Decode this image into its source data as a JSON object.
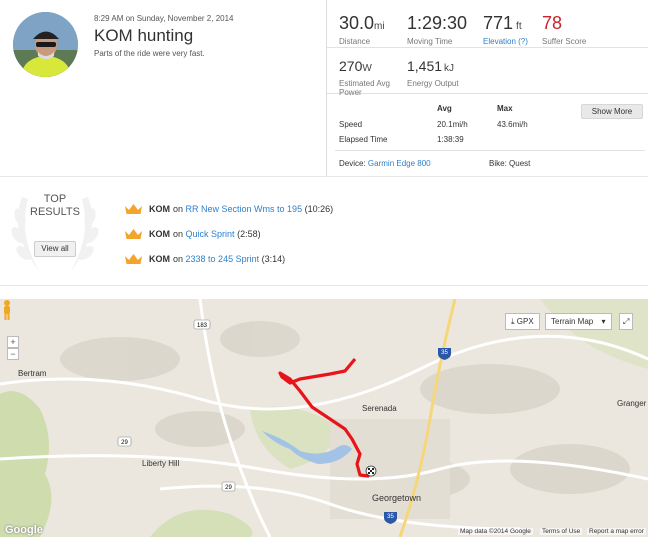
{
  "activity": {
    "timestamp": "8:29 AM on Sunday, November 2, 2014",
    "title": "KOM hunting",
    "description": "Parts of the ride were very fast."
  },
  "stats": {
    "distance": {
      "value": "30.0",
      "unit": "mi",
      "label": "Distance"
    },
    "moving_time": {
      "value": "1:29:30",
      "label": "Moving Time"
    },
    "elevation": {
      "value": "771",
      "unit": "ft",
      "label": "Elevation (?)"
    },
    "suffer": {
      "value": "78",
      "label": "Suffer Score"
    },
    "power": {
      "value": "270",
      "unit": "W",
      "label_line1": "Estimated Avg",
      "label_line2": "Power"
    },
    "energy": {
      "value": "1,451",
      "unit": "kJ",
      "label": "Energy Output"
    }
  },
  "more_stats": {
    "col_avg": "Avg",
    "col_max": "Max",
    "speed_label": "Speed",
    "speed_avg": "20.1mi/h",
    "speed_max": "43.6mi/h",
    "elapsed_label": "Elapsed Time",
    "elapsed_value": "1:38:39",
    "show_more": "Show More"
  },
  "gear": {
    "device_label": "Device:",
    "device_name": "Garmin Edge 800",
    "bike_label": "Bike:",
    "bike_name": "Quest"
  },
  "top_results": {
    "title_line1": "TOP",
    "title_line2": "RESULTS",
    "view_all": "View all",
    "items": [
      {
        "badge": "KOM",
        "on": "on",
        "segment": "RR New Section Wms to 195",
        "time": "(10:26)"
      },
      {
        "badge": "KOM",
        "on": "on",
        "segment": "Quick Sprint",
        "time": "(2:58)"
      },
      {
        "badge": "KOM",
        "on": "on",
        "segment": "2338 to 245 Sprint",
        "time": "(3:14)"
      }
    ]
  },
  "map": {
    "gpx": "GPX",
    "terrain": "Terrain Map",
    "zoom_in": "+",
    "zoom_out": "−",
    "places": {
      "bertram": "Bertram",
      "serenada": "Serenada",
      "granger": "Granger",
      "liberty_hill": "Liberty Hill",
      "georgetown": "Georgetown"
    },
    "shields": {
      "r183": "183",
      "r29a": "29",
      "r29b": "29",
      "r35a": "35",
      "r35b": "35"
    },
    "footer": {
      "google": "Google",
      "data": "Map data ©2014 Google",
      "terms": "Terms of Use",
      "report": "Report a map error"
    }
  },
  "colors": {
    "link": "#2f80c8",
    "suffer_red": "#c9232d",
    "route_red": "#e8141b",
    "crown_gold": "#f2a42b"
  }
}
